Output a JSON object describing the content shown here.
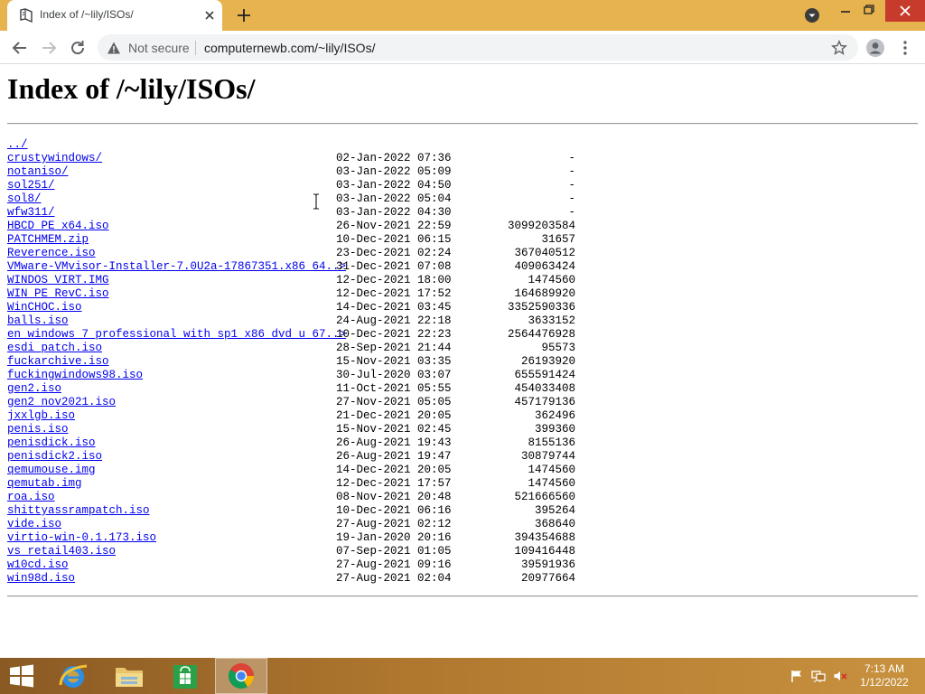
{
  "browser": {
    "tab_title": "Index of /~lily/ISOs/",
    "security_label": "Not secure",
    "url": "computernewb.com/~lily/ISOs/"
  },
  "page": {
    "title": "Index of /~lily/ISOs/",
    "entries": [
      {
        "name": "../",
        "date": "",
        "size": ""
      },
      {
        "name": "crustywindows/",
        "date": "02-Jan-2022 07:36",
        "size": "-"
      },
      {
        "name": "notaniso/",
        "date": "03-Jan-2022 05:09",
        "size": "-"
      },
      {
        "name": "sol251/",
        "date": "03-Jan-2022 04:50",
        "size": "-"
      },
      {
        "name": "sol8/",
        "date": "03-Jan-2022 05:04",
        "size": "-"
      },
      {
        "name": "wfw311/",
        "date": "03-Jan-2022 04:30",
        "size": "-"
      },
      {
        "name": "HBCD_PE_x64.iso",
        "date": "26-Nov-2021 22:59",
        "size": "3099203584"
      },
      {
        "name": "PATCHMEM.zip",
        "date": "10-Dec-2021 06:15",
        "size": "31657"
      },
      {
        "name": "Reverence.iso",
        "date": "23-Dec-2021 02:24",
        "size": "367040512"
      },
      {
        "name": "VMware-VMvisor-Installer-7.0U2a-17867351.x86_64..>",
        "date": "31-Dec-2021 07:08",
        "size": "409063424"
      },
      {
        "name": "WINDOS_VIRT.IMG",
        "date": "12-Dec-2021 18:00",
        "size": "1474560"
      },
      {
        "name": "WIN_PE_RevC.iso",
        "date": "12-Dec-2021 17:52",
        "size": "164689920"
      },
      {
        "name": "WinCHOC.iso",
        "date": "14-Dec-2021 03:45",
        "size": "3352590336"
      },
      {
        "name": "balls.iso",
        "date": "24-Aug-2021 22:18",
        "size": "3633152"
      },
      {
        "name": "en_windows_7_professional_with_sp1_x86_dvd_u_67..>",
        "date": "10-Dec-2021 22:23",
        "size": "2564476928"
      },
      {
        "name": "esdi_patch.iso",
        "date": "28-Sep-2021 21:44",
        "size": "95573"
      },
      {
        "name": "fuckarchive.iso",
        "date": "15-Nov-2021 03:35",
        "size": "26193920"
      },
      {
        "name": "fuckingwindows98.iso",
        "date": "30-Jul-2020 03:07",
        "size": "655591424"
      },
      {
        "name": "gen2.iso",
        "date": "11-Oct-2021 05:55",
        "size": "454033408"
      },
      {
        "name": "gen2_nov2021.iso",
        "date": "27-Nov-2021 05:05",
        "size": "457179136"
      },
      {
        "name": "jxxlgb.iso",
        "date": "21-Dec-2021 20:05",
        "size": "362496"
      },
      {
        "name": "penis.iso",
        "date": "15-Nov-2021 02:45",
        "size": "399360"
      },
      {
        "name": "penisdick.iso",
        "date": "26-Aug-2021 19:43",
        "size": "8155136"
      },
      {
        "name": "penisdick2.iso",
        "date": "26-Aug-2021 19:47",
        "size": "30879744"
      },
      {
        "name": "qemumouse.img",
        "date": "14-Dec-2021 20:05",
        "size": "1474560"
      },
      {
        "name": "qemutab.img",
        "date": "12-Dec-2021 17:57",
        "size": "1474560"
      },
      {
        "name": "roa.iso",
        "date": "08-Nov-2021 20:48",
        "size": "521666560"
      },
      {
        "name": "shittyassrampatch.iso",
        "date": "10-Dec-2021 06:16",
        "size": "395264"
      },
      {
        "name": "vide.iso",
        "date": "27-Aug-2021 02:12",
        "size": "368640"
      },
      {
        "name": "virtio-win-0.1.173.iso",
        "date": "19-Jan-2020 20:16",
        "size": "394354688"
      },
      {
        "name": "vs_retail403.iso",
        "date": "07-Sep-2021 01:05",
        "size": "109416448"
      },
      {
        "name": "w10cd.iso",
        "date": "27-Aug-2021 09:16",
        "size": "39591936"
      },
      {
        "name": "win98d.iso",
        "date": "27-Aug-2021 02:04",
        "size": "20977664"
      }
    ]
  },
  "taskbar": {
    "apps": [
      "internet-explorer",
      "file-explorer",
      "store",
      "chrome"
    ],
    "active_app": "chrome",
    "clock_time": "7:13 AM",
    "clock_date": "1/12/2022"
  },
  "icons": {
    "tab_favicon": "book-favicon-icon",
    "tab_close": "close-icon",
    "new_tab": "plus-icon",
    "back": "back-arrow-icon",
    "forward": "forward-arrow-icon",
    "reload": "reload-icon",
    "security": "info-icon",
    "bookmark": "star-icon",
    "profile": "profile-icon",
    "menu": "kebab-menu-icon",
    "start": "windows-start-icon",
    "tray": [
      "flag-icon",
      "network-icon",
      "volume-muted-icon"
    ]
  },
  "colors": {
    "titlebar": "#e6b34f",
    "link": "#0000ee",
    "taskbar": "#b0782f",
    "close_button": "#c73b2d"
  }
}
